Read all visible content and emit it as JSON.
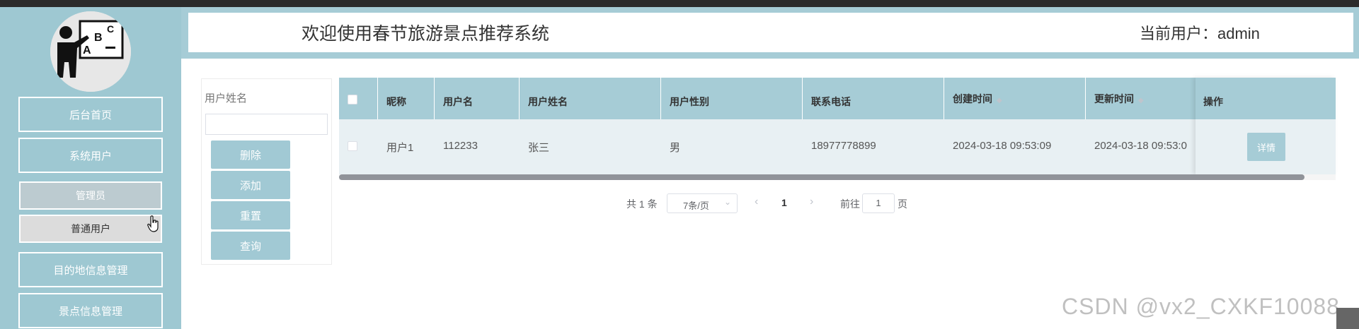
{
  "header": {
    "title": "欢迎使用春节旅游景点推荐系统",
    "current_user": "当前用户：admin"
  },
  "sidebar": {
    "items": [
      {
        "label": "后台首页"
      },
      {
        "label": "系统用户"
      },
      {
        "label": "管理员"
      },
      {
        "label": "普通用户"
      },
      {
        "label": "目的地信息管理"
      },
      {
        "label": "景点信息管理"
      }
    ]
  },
  "search": {
    "field_label": "用户姓名",
    "value": "",
    "buttons": {
      "delete": "删除",
      "add": "添加",
      "reset": "重置",
      "query": "查询"
    }
  },
  "table": {
    "columns": [
      "昵称",
      "用户名",
      "用户姓名",
      "用户性别",
      "联系电话",
      "创建时间",
      "更新时间",
      "操作"
    ],
    "rows": [
      {
        "nickname": "用户1",
        "username": "112233",
        "real_name": "张三",
        "gender": "男",
        "phone": "18977778899",
        "created_at": "2024-03-18 09:53:09",
        "updated_at": "2024-03-18 09:53:0",
        "action": "详情"
      }
    ]
  },
  "pagination": {
    "total_text": "共 1 条",
    "page_size": "7条/页",
    "prev": "‹",
    "current_page": "1",
    "next": "›",
    "goto_label": "前往",
    "goto_value": "1",
    "page_suffix": "页"
  },
  "watermark": "CSDN @vx2_CXKF10088",
  "colors": {
    "accent": "#a6ccd6",
    "sidebar": "#9ec8d2"
  }
}
